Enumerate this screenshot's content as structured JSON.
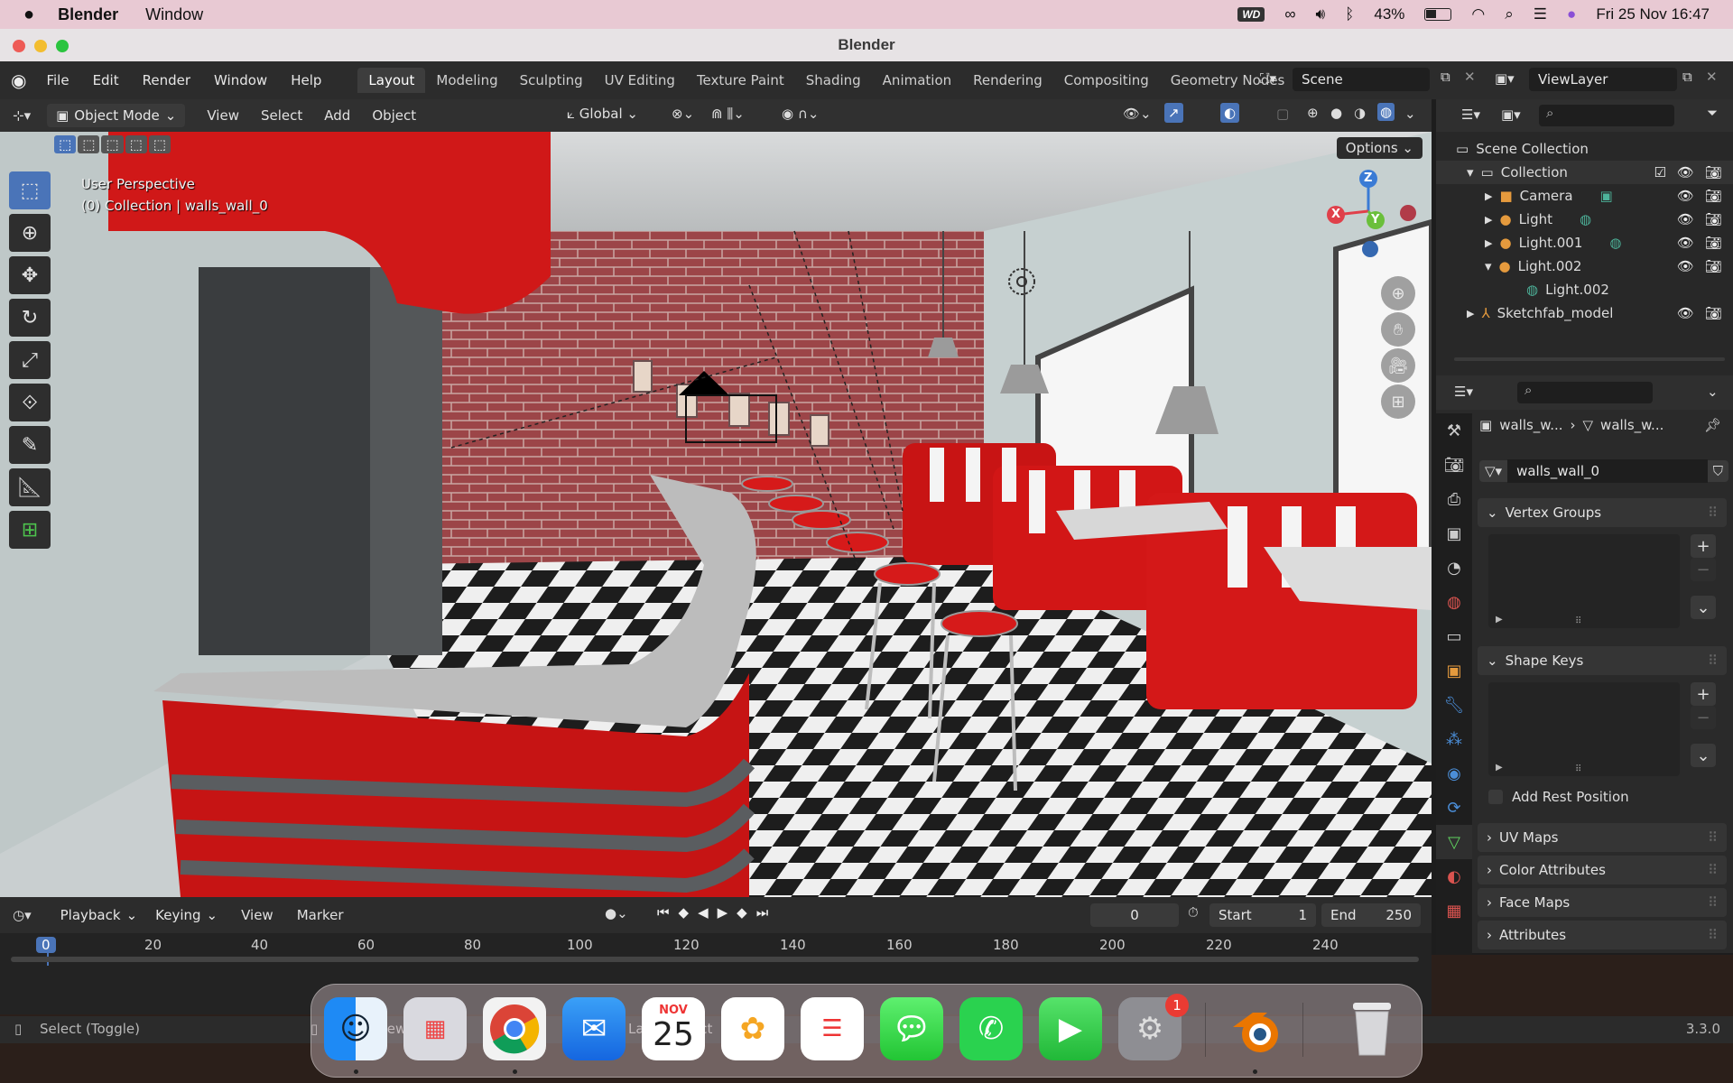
{
  "menubar": {
    "apple": "",
    "app_name": "Blender",
    "items": [
      "Window"
    ],
    "battery": "43%",
    "datetime": "Fri 25 Nov  16:47",
    "wd_label": "WD"
  },
  "window": {
    "title": "Blender"
  },
  "topbar": {
    "menus": [
      "File",
      "Edit",
      "Render",
      "Window",
      "Help"
    ],
    "workspaces": [
      "Layout",
      "Modeling",
      "Sculpting",
      "UV Editing",
      "Texture Paint",
      "Shading",
      "Animation",
      "Rendering",
      "Compositing",
      "Geometry Nodes"
    ],
    "active_workspace": "Layout",
    "scene": "Scene",
    "view_layer": "ViewLayer"
  },
  "viewport_header": {
    "mode": "Object Mode",
    "menus": [
      "View",
      "Select",
      "Add",
      "Object"
    ],
    "orientation": "Global"
  },
  "viewport": {
    "perspective": "User Perspective",
    "context": "(0) Collection | walls_wall_0",
    "options": "Options",
    "gizmo": {
      "z": "Z",
      "y": "Y",
      "x": "X"
    }
  },
  "outliner": {
    "scene_collection": "Scene Collection",
    "items": [
      {
        "label": "Collection",
        "level": 0
      },
      {
        "label": "Camera",
        "level": 1
      },
      {
        "label": "Light",
        "level": 1
      },
      {
        "label": "Light.001",
        "level": 1
      },
      {
        "label": "Light.002",
        "level": 1
      },
      {
        "label": "Light.002",
        "level": 2
      },
      {
        "label": "Sketchfab_model",
        "level": 0
      }
    ]
  },
  "properties": {
    "breadcrumb_obj": "walls_w...",
    "breadcrumb_mesh": "walls_w...",
    "mesh_name": "walls_wall_0",
    "panels": {
      "vertex_groups": "Vertex Groups",
      "shape_keys": "Shape Keys",
      "add_rest_position": "Add Rest Position",
      "uv_maps": "UV Maps",
      "color_attributes": "Color Attributes",
      "face_maps": "Face Maps",
      "attributes": "Attributes"
    }
  },
  "timeline": {
    "menus": [
      "Playback",
      "Keying",
      "View",
      "Marker"
    ],
    "current_frame": "0",
    "start_label": "Start",
    "start": "1",
    "end_label": "End",
    "end": "250",
    "ruler": [
      "0",
      "20",
      "40",
      "60",
      "80",
      "100",
      "120",
      "140",
      "160",
      "180",
      "200",
      "220",
      "240"
    ]
  },
  "statusbar": {
    "select": "Select (Toggle)",
    "dolly": "Dolly View",
    "lasso": "Lasso Select",
    "version": "3.3.0"
  },
  "dock": {
    "calendar_month": "NOV",
    "calendar_day": "25",
    "badge": "1"
  },
  "colors": {
    "accent": "#4a74b8",
    "menubar": "#e8c9d3",
    "diner_red": "#d01818"
  }
}
